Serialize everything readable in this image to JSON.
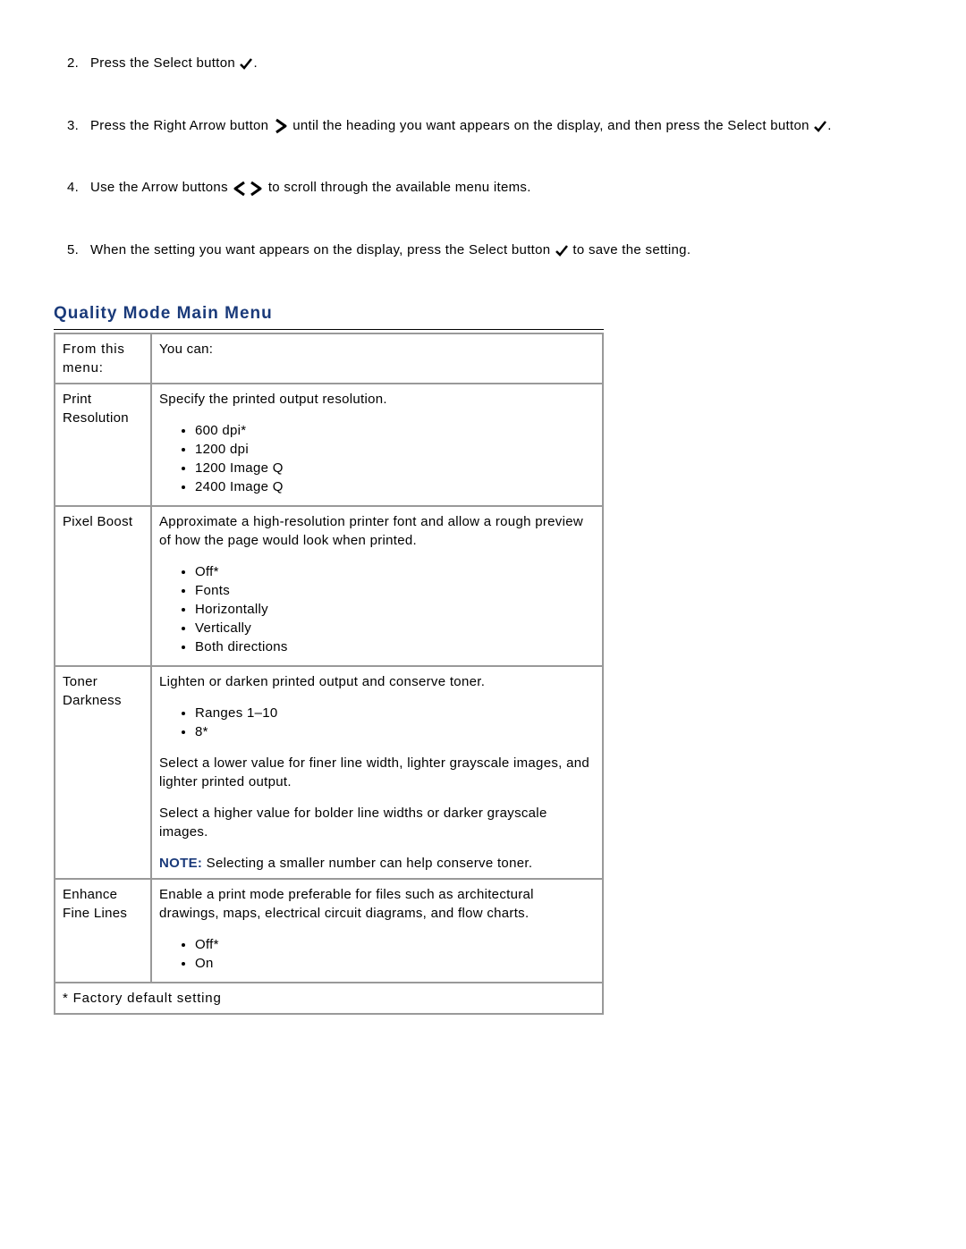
{
  "steps": [
    {
      "num": "2.",
      "t1": "Press the Select button ",
      "t2": "."
    },
    {
      "num": "3.",
      "t1": "Press the Right Arrow button ",
      "t2": " until the heading you want appears on the display, and then press the Select button ",
      "t3": "."
    },
    {
      "num": "4.",
      "t1": "Use the Arrow buttons ",
      "t2": " to scroll through the available menu items."
    },
    {
      "num": "5.",
      "t1": "When the setting you want appears on the display, press the Select button ",
      "t2": " to save the setting."
    }
  ],
  "section_title": "Quality Mode Main Menu",
  "header": {
    "left": "From this menu:",
    "right": "You can:"
  },
  "rows": [
    {
      "left": "Print Resolution",
      "desc": "Specify the printed output resolution.",
      "items": [
        "600 dpi*",
        "1200 dpi",
        "1200 Image Q",
        "2400 Image Q"
      ]
    },
    {
      "left": "Pixel Boost",
      "desc": "Approximate a high-resolution printer font and allow a rough preview of how the page would look when printed.",
      "items": [
        "Off*",
        "Fonts",
        "Horizontally",
        "Vertically",
        "Both directions"
      ]
    },
    {
      "left": "Toner Darkness",
      "desc": "Lighten or darken printed output and conserve toner.",
      "items": [
        "Ranges 1–10",
        "8*"
      ],
      "p1": "Select a lower value for finer line width, lighter grayscale images, and lighter printed output.",
      "p2": "Select a higher value for bolder line widths or darker grayscale images.",
      "note_label": "NOTE: ",
      "note": " Selecting a smaller number can help conserve toner."
    },
    {
      "left": "Enhance Fine Lines",
      "desc": "Enable a print mode preferable for files such as architectural drawings, maps, electrical circuit diagrams, and flow charts.",
      "items": [
        "Off*",
        "On"
      ]
    }
  ],
  "footer": "* Factory default setting"
}
